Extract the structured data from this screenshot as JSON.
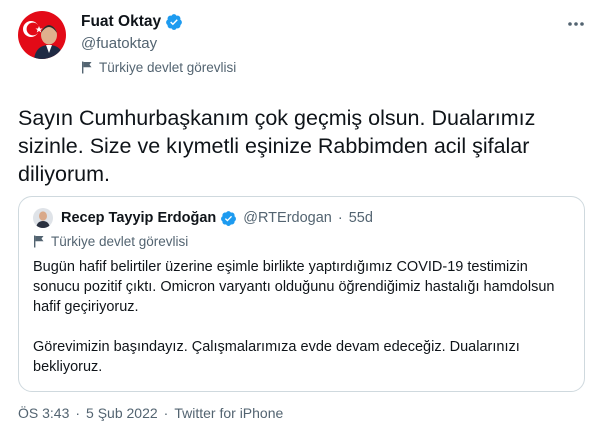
{
  "author": {
    "name": "Fuat Oktay",
    "handle": "@fuatoktay",
    "label": "Türkiye devlet görevlisi"
  },
  "icons": {
    "verified": "verified-badge-icon",
    "flag": "flag-icon",
    "more": "more-options-icon"
  },
  "tweet": {
    "text": "Sayın Cumhurbaşkanım çok geçmiş olsun. Dualarımız sizinle. Size ve kıymetli eşinize Rabbimden acil şifalar diliyorum."
  },
  "quote": {
    "name": "Recep Tayyip Erdoğan",
    "handle": "@RTErdogan",
    "dot": "·",
    "age": "55d",
    "label": "Türkiye devlet görevlisi",
    "paragraph1": "Bugün hafif belirtiler üzerine eşimle birlikte yaptırdığımız COVID-19 testimizin sonucu pozitif çıktı. Omicron varyantı olduğunu öğrendiğimiz hastalığı hamdolsun hafif geçiriyoruz.",
    "paragraph2": "Görevimizin başındayız. Çalışmalarımıza evde devam edeceğiz. Dualarınızı bekliyoruz."
  },
  "meta": {
    "time": "ÖS 3:43",
    "dot1": "·",
    "date": "5 Şub 2022",
    "dot2": "·",
    "source": "Twitter for iPhone"
  },
  "colors": {
    "verified": "#1d9bf0",
    "text": "#0f1419",
    "secondary": "#536471",
    "border": "#cfd9de",
    "flag_red": "#e30a17"
  }
}
